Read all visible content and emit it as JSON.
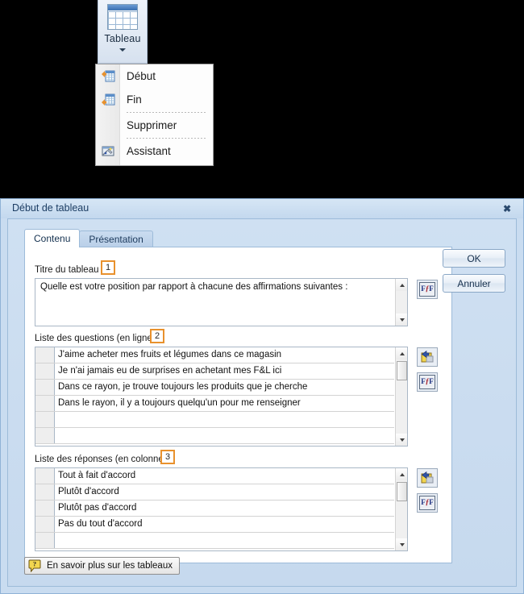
{
  "ribbon": {
    "button_label": "Tableau",
    "icon": "table-icon",
    "dropdown_caret": "chevron-down-icon"
  },
  "menu": {
    "items": [
      {
        "label": "Début",
        "icon": "table-start-icon",
        "separator_after": false
      },
      {
        "label": "Fin",
        "icon": "table-end-icon",
        "separator_after": true
      },
      {
        "label": "Supprimer",
        "icon": "",
        "separator_after": true
      },
      {
        "label": "Assistant",
        "icon": "wizard-wand-icon",
        "separator_after": false
      }
    ]
  },
  "dialog": {
    "title": "Début de tableau",
    "close_icon": "close-icon",
    "tabs": [
      {
        "label": "Contenu",
        "active": true
      },
      {
        "label": "Présentation",
        "active": false
      }
    ],
    "buttons": {
      "ok": "OK",
      "cancel": "Annuler",
      "help": "En savoir plus sur les tableaux",
      "help_icon": "help-bubble-icon"
    },
    "sections": {
      "title_field": {
        "label": "Titre du tableau :",
        "badge": "1",
        "value": "Quelle est votre position par rapport à chacune des affirmations suivantes :",
        "side_buttons": [
          {
            "icon": "font-format-icon",
            "name": "format-font-button"
          }
        ]
      },
      "questions": {
        "label": "Liste des questions (en ligne)",
        "badge": "2",
        "rows": [
          "J'aime acheter mes fruits et légumes dans ce magasin",
          "Je n'ai jamais eu de surprises en achetant mes F&L ici",
          "Dans ce rayon, je trouve toujours les produits que je cherche",
          "Dans le rayon, il y a toujours quelqu'un pour me renseigner",
          "",
          ""
        ],
        "side_buttons": [
          {
            "icon": "import-list-icon",
            "name": "import-questions-button"
          },
          {
            "icon": "font-format-icon",
            "name": "format-questions-button"
          }
        ]
      },
      "answers": {
        "label": "Liste des réponses (en colonne)",
        "badge": "3",
        "rows": [
          "Tout à fait d'accord",
          "Plutôt d'accord",
          "Plutôt pas d'accord",
          "Pas du tout d'accord",
          ""
        ],
        "side_buttons": [
          {
            "icon": "import-list-icon",
            "name": "import-answers-button"
          },
          {
            "icon": "font-format-icon",
            "name": "format-answers-button"
          }
        ]
      }
    }
  },
  "colors": {
    "dialog_bg": "#c9dcf0",
    "badge_border": "#e8912d",
    "title_text": "#1c3d63",
    "panel_bg": "#ffffff"
  }
}
